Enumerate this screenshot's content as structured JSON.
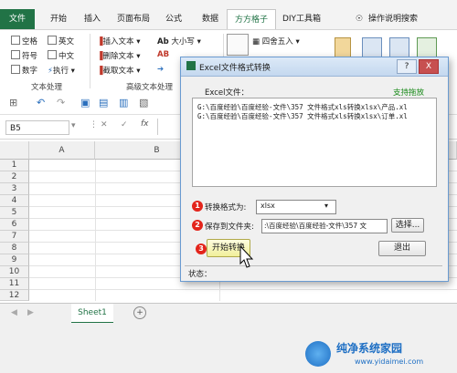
{
  "tabs": [
    "文件",
    "开始",
    "插入",
    "页面布局",
    "公式",
    "数据",
    "方方格子",
    "DIY工具箱"
  ],
  "tell_me": "操作说明搜索",
  "ribbon": {
    "checks": [
      "空格",
      "英文",
      "符号",
      "中文",
      "数字"
    ],
    "execute": "执行",
    "text_group_label": "文本处理",
    "advanced_items": [
      "插入文本",
      "删除文本",
      "截取文本"
    ],
    "case_label": "大小写",
    "advanced_group_label": "高级文本处理",
    "round_label": "四舍五入"
  },
  "namebox": "B5",
  "fx": "fx",
  "columns": [
    "A",
    "B"
  ],
  "rows": [
    "1",
    "2",
    "3",
    "4",
    "5",
    "6",
    "7",
    "8",
    "9",
    "10",
    "11",
    "12"
  ],
  "sheet_tab": "Sheet1",
  "dialog": {
    "title": "Excel文件格式转换",
    "help": "?",
    "close": "X",
    "file_label": "Excel文件：",
    "drag_label": "支持拖放",
    "files": [
      "G:\\百度经验\\百度经验-文件\\357 文件格式xls转换xlsx\\产品.xl",
      "G:\\百度经验\\百度经验-文件\\357 文件格式xls转换xlsx\\订单.xl"
    ],
    "format_label": "转换格式为:",
    "format_value": "xlsx",
    "save_label": "保存到文件夹:",
    "save_path": ":\\百度经验\\百度经验-文件\\357 文",
    "choose_button": "选择...",
    "start_button": "开始转换",
    "exit_button": "退出",
    "status_label": "状态：",
    "steps": [
      "1",
      "2",
      "3"
    ]
  },
  "watermark": {
    "title": "纯净系统家园",
    "url": "www.yidaimei.com"
  },
  "colors": {
    "excel_green": "#217346",
    "badge_red": "#e3241b",
    "drag_green": "#1a8a1a"
  }
}
